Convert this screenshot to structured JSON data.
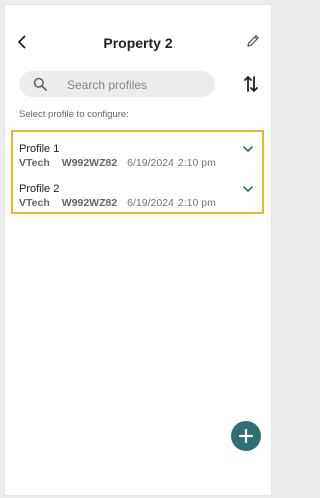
{
  "header": {
    "title": "Property 2",
    "back_icon": "chevron-left-icon",
    "edit_icon": "pencil-icon"
  },
  "search": {
    "placeholder": "Search profiles",
    "value": "",
    "icon": "search-icon"
  },
  "sort_icon": "sort-arrows-icon",
  "hint": "Select profile to configure:",
  "profiles": [
    {
      "name": "Profile 1",
      "brand": "VTech",
      "model": "W992WZ82",
      "date": "6/19/2024",
      "time": "2:10 pm"
    },
    {
      "name": "Profile 2",
      "brand": "VTech",
      "model": "W992WZ82",
      "date": "6/19/2024",
      "time": "2:10 pm"
    }
  ],
  "fab_icon": "plus-icon",
  "colors": {
    "accent": "#2f6f73",
    "highlight_border": "#f0b429",
    "search_bg": "#ececec"
  }
}
